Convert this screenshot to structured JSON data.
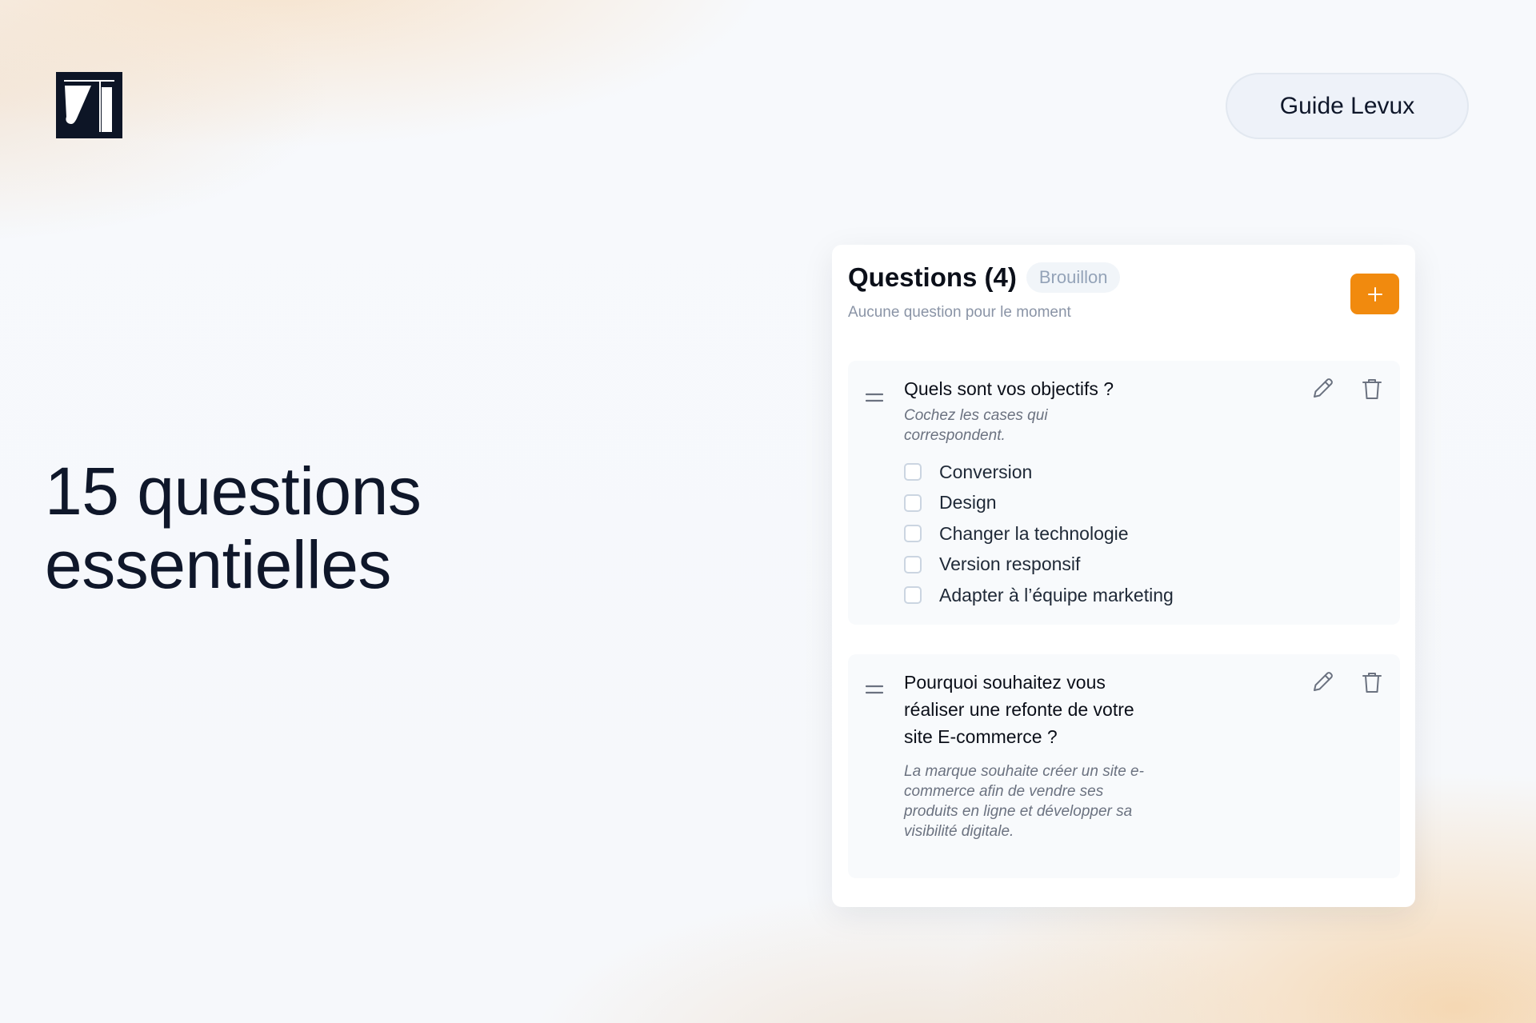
{
  "hero": {
    "headline_line1": "15 questions",
    "headline_line2": "essentielles"
  },
  "header": {
    "guide_button_label": "Guide Levux",
    "logo_icon": "levux-logo-icon"
  },
  "panel": {
    "title": "Questions (4)",
    "status_badge": "Brouillon",
    "subtitle": "Aucune question pour le moment",
    "add_button_icon": "plus-icon",
    "accent_color": "#f18a0e"
  },
  "questions": [
    {
      "title": "Quels sont vos objectifs ?",
      "description": "Cochez les cases qui correspondent.",
      "options": [
        "Conversion",
        "Design",
        "Changer la technologie",
        "Version responsif",
        "Adapter à l’équipe marketing"
      ]
    },
    {
      "title": "Pourquoi souhaitez vous réaliser une refonte de votre site E-commerce ?",
      "description": "La marque souhaite créer un site e-commerce afin de vendre ses produits en ligne et développer sa visibilité digitale."
    }
  ],
  "icons": {
    "drag": "drag-handle-icon",
    "edit": "pencil-icon",
    "delete": "trash-icon"
  }
}
